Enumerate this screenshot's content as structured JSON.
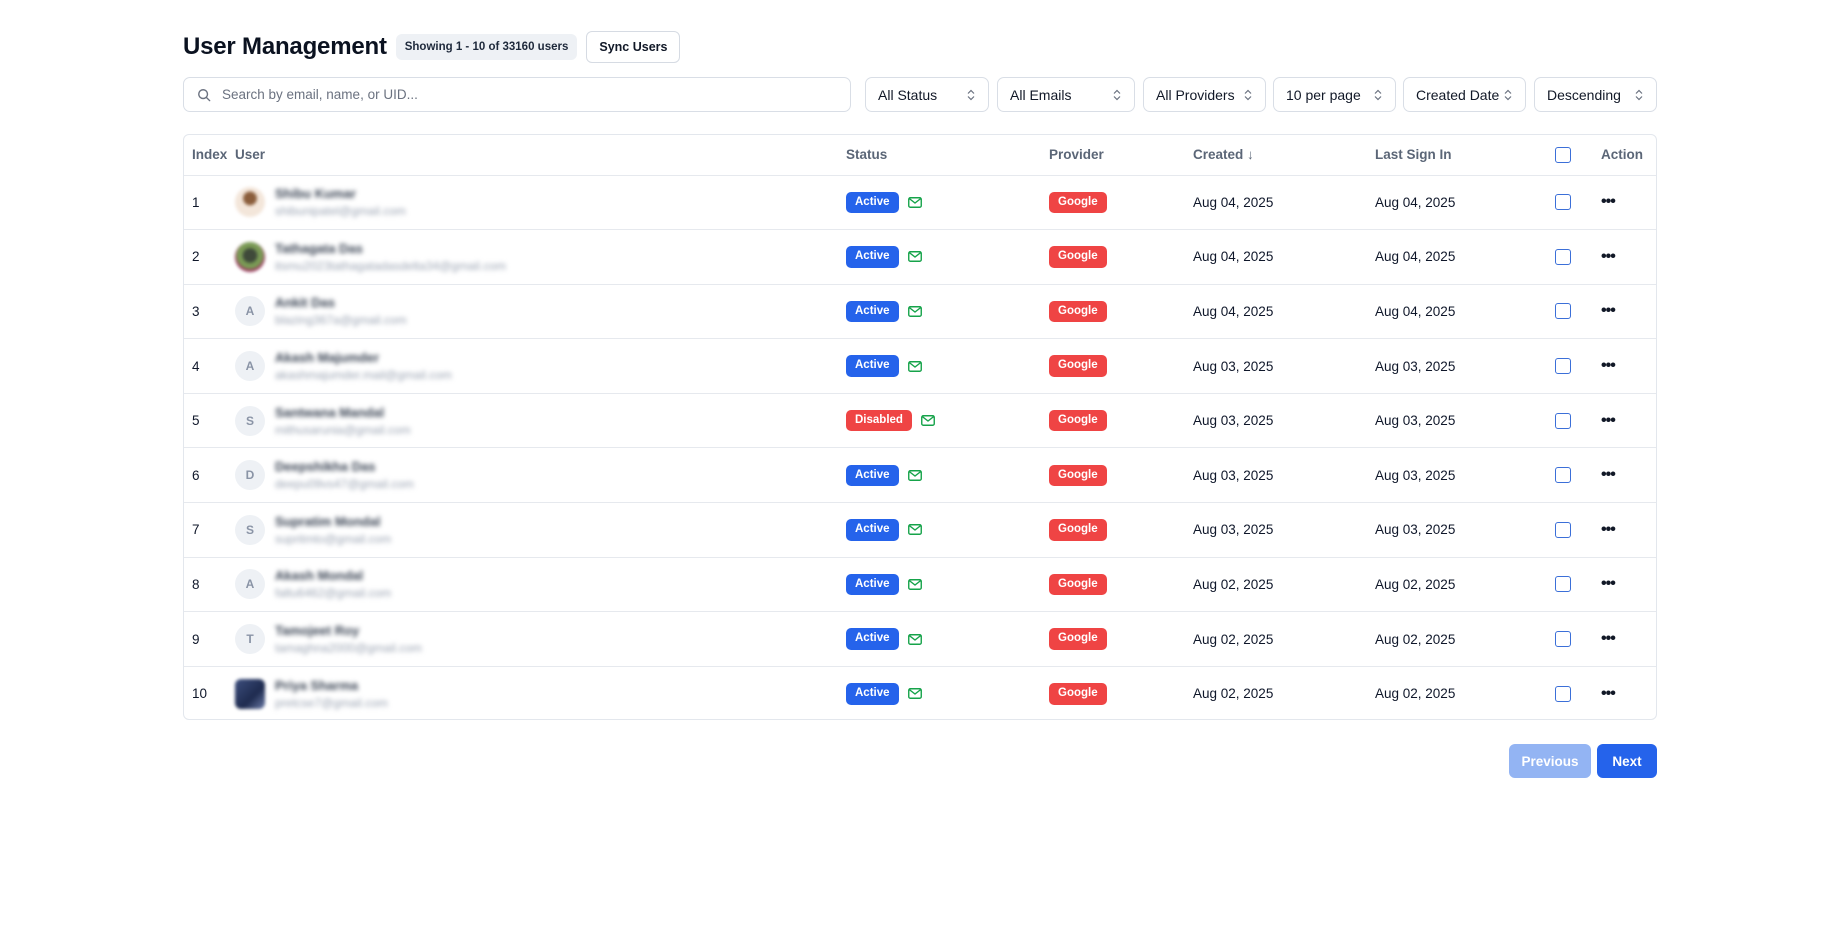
{
  "header": {
    "title": "User Management",
    "count_label": "Showing 1 - 10 of 33160 users",
    "sync_label": "Sync Users"
  },
  "filters": {
    "search_placeholder": "Search by email, name, or UID...",
    "status": "All Status",
    "emails": "All Emails",
    "providers": "All Providers",
    "per_page": "10 per page",
    "sort_field": "Created Date",
    "sort_order": "Descending"
  },
  "table": {
    "columns": {
      "index": "Index",
      "user": "User",
      "status": "Status",
      "provider": "Provider",
      "created": "Created ↓",
      "last_sign_in": "Last Sign In",
      "action": "Action"
    },
    "rows": [
      {
        "index": "1",
        "avatar": "",
        "avatar_type": "photo-1",
        "name": "Shibu Kumar",
        "email": "shibunipatel@gmail.com",
        "status": "Active",
        "provider": "Google",
        "created": "Aug 04, 2025",
        "last_sign_in": "Aug 04, 2025"
      },
      {
        "index": "2",
        "avatar": "",
        "avatar_type": "photo-2",
        "name": "Tathagata Das",
        "email": "itsmu2023tathagatadasdelta34@gmail.com",
        "status": "Active",
        "provider": "Google",
        "created": "Aug 04, 2025",
        "last_sign_in": "Aug 04, 2025"
      },
      {
        "index": "3",
        "avatar": "A",
        "avatar_type": "initial",
        "name": "Ankit Das",
        "email": "blazing367a@gmail.com",
        "status": "Active",
        "provider": "Google",
        "created": "Aug 04, 2025",
        "last_sign_in": "Aug 04, 2025"
      },
      {
        "index": "4",
        "avatar": "A",
        "avatar_type": "initial",
        "name": "Akash Majumder",
        "email": "akashmajumder.mail@gmail.com",
        "status": "Active",
        "provider": "Google",
        "created": "Aug 03, 2025",
        "last_sign_in": "Aug 03, 2025"
      },
      {
        "index": "5",
        "avatar": "S",
        "avatar_type": "initial",
        "name": "Santwana Mandal",
        "email": "mithusarunia@gmail.com",
        "status": "Disabled",
        "provider": "Google",
        "created": "Aug 03, 2025",
        "last_sign_in": "Aug 03, 2025"
      },
      {
        "index": "6",
        "avatar": "D",
        "avatar_type": "initial",
        "name": "Deepshikha Das",
        "email": "deepu09vs47@gmail.com",
        "status": "Active",
        "provider": "Google",
        "created": "Aug 03, 2025",
        "last_sign_in": "Aug 03, 2025"
      },
      {
        "index": "7",
        "avatar": "S",
        "avatar_type": "initial",
        "name": "Supratim Mondal",
        "email": "supritmto@gmail.com",
        "status": "Active",
        "provider": "Google",
        "created": "Aug 03, 2025",
        "last_sign_in": "Aug 03, 2025"
      },
      {
        "index": "8",
        "avatar": "A",
        "avatar_type": "initial",
        "name": "Akash Mondal",
        "email": "faltu6462@gmail.com",
        "status": "Active",
        "provider": "Google",
        "created": "Aug 02, 2025",
        "last_sign_in": "Aug 02, 2025"
      },
      {
        "index": "9",
        "avatar": "T",
        "avatar_type": "initial",
        "name": "Tamojeet Roy",
        "email": "tamaghna2000@gmail.com",
        "status": "Active",
        "provider": "Google",
        "created": "Aug 02, 2025",
        "last_sign_in": "Aug 02, 2025"
      },
      {
        "index": "10",
        "avatar": "",
        "avatar_type": "photo-10",
        "name": "Priya Sharma",
        "email": "pretcse7@gmail.com",
        "status": "Active",
        "provider": "Google",
        "created": "Aug 02, 2025",
        "last_sign_in": "Aug 02, 2025"
      }
    ]
  },
  "pagination": {
    "previous_label": "Previous",
    "next_label": "Next"
  },
  "colors": {
    "primary": "#2563eb",
    "danger": "#ef4444",
    "email_verified": "#16a34a",
    "disabled_button": "#93b4f3"
  },
  "icons": {
    "search": "search-icon",
    "select_chevron": "chevron-updown-icon",
    "email_verified": "mail-icon",
    "row_action": "more-horizontal-icon"
  }
}
